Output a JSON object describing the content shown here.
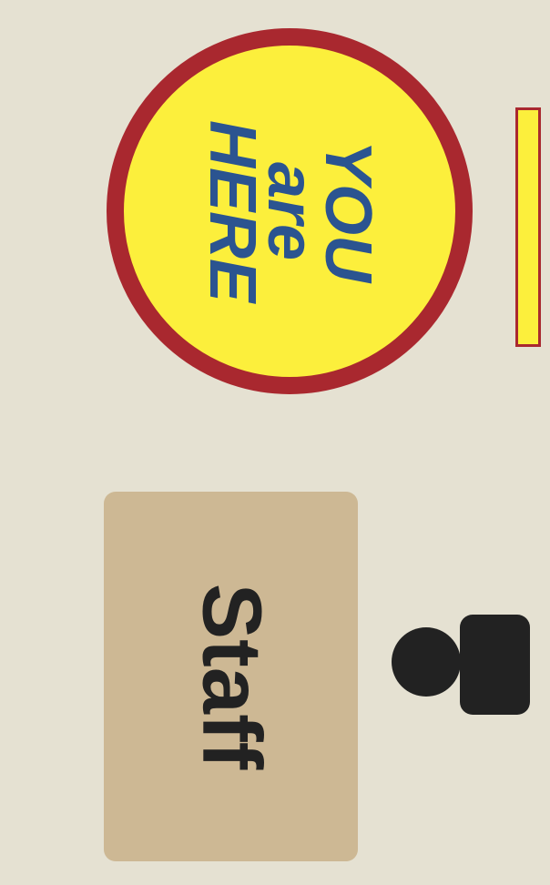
{
  "marker": {
    "line1": "YOU",
    "line2": "are",
    "line3": "HERE"
  },
  "staff_area": {
    "label": "Staff"
  },
  "icons": {
    "staff_person": "person-icon"
  },
  "colors": {
    "background": "#e5e1d2",
    "marker_fill": "#fcef3c",
    "marker_ring": "#a9282f",
    "marker_text": "#2b5490",
    "staff_fill": "#cdb894",
    "staff_text": "#222222",
    "icon": "#222222"
  }
}
